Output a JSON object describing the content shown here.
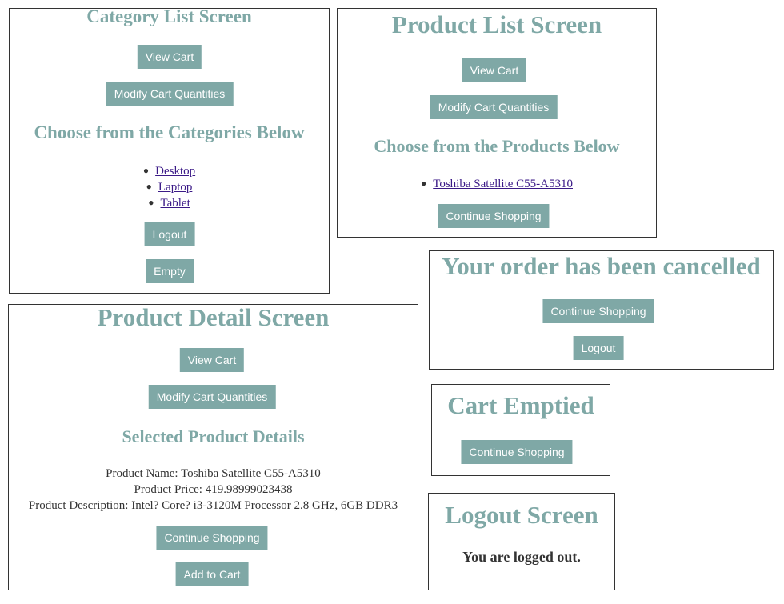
{
  "category_screen": {
    "title": "Category List Screen",
    "view_cart": "View Cart",
    "modify_cart": "Modify Cart Quantities",
    "subtitle": "Choose from the Categories Below",
    "categories": [
      "Desktop",
      "Laptop",
      "Tablet"
    ],
    "logout": "Logout",
    "empty": "Empty"
  },
  "product_list_screen": {
    "title": "Product List Screen",
    "view_cart": "View Cart",
    "modify_cart": "Modify Cart Quantities",
    "subtitle": "Choose from the Products Below",
    "products": [
      "Toshiba Satellite C55-A5310"
    ],
    "continue_shopping": "Continue Shopping"
  },
  "order_cancelled_screen": {
    "title": "Your order has been cancelled",
    "continue_shopping": "Continue Shopping",
    "logout": "Logout"
  },
  "product_detail_screen": {
    "title": "Product Detail Screen",
    "view_cart": "View Cart",
    "modify_cart": "Modify Cart Quantities",
    "subtitle": "Selected Product Details",
    "product_name": "Product Name: Toshiba Satellite C55-A5310",
    "product_price": "Product Price: 419.98999023438",
    "product_description": "Product Description: Intel? Core? i3-3120M Processor 2.8 GHz, 6GB DDR3",
    "continue_shopping": "Continue Shopping",
    "add_to_cart": "Add to Cart"
  },
  "cart_emptied_screen": {
    "title": "Cart Emptied",
    "continue_shopping": "Continue Shopping"
  },
  "logout_screen": {
    "title": "Logout Screen",
    "message": "You are logged out."
  },
  "colors": {
    "accent": "#7fa8a6",
    "link": "#3b1a87",
    "text": "#333333",
    "border": "#333333"
  }
}
